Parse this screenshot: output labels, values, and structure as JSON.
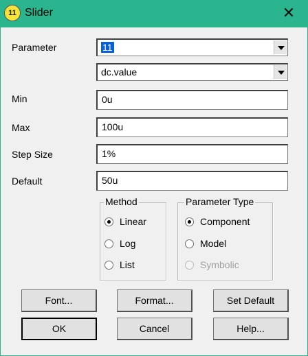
{
  "window": {
    "title": "Slider",
    "icon_text": "11"
  },
  "form": {
    "parameter_label": "Parameter",
    "parameter_value": "11",
    "parameter_sub_value": "dc.value",
    "min_label": "Min",
    "min_value": "0u",
    "max_label": "Max",
    "max_value": "100u",
    "step_label": "Step Size",
    "step_value": "1%",
    "default_label": "Default",
    "default_value": "50u"
  },
  "method": {
    "title": "Method",
    "options": [
      {
        "label": "Linear",
        "selected": true
      },
      {
        "label": "Log",
        "selected": false
      },
      {
        "label": "List",
        "selected": false
      }
    ]
  },
  "parameter_type": {
    "title": "Parameter Type",
    "options": [
      {
        "label": "Component",
        "selected": true,
        "enabled": true
      },
      {
        "label": "Model",
        "selected": false,
        "enabled": true
      },
      {
        "label": "Symbolic",
        "selected": false,
        "enabled": false
      }
    ]
  },
  "buttons": {
    "font": "Font...",
    "format": "Format...",
    "set_default": "Set Default",
    "ok": "OK",
    "cancel": "Cancel",
    "help": "Help..."
  },
  "colors": {
    "titlebar": "#2bb58f",
    "selection": "#0a5fd8"
  }
}
